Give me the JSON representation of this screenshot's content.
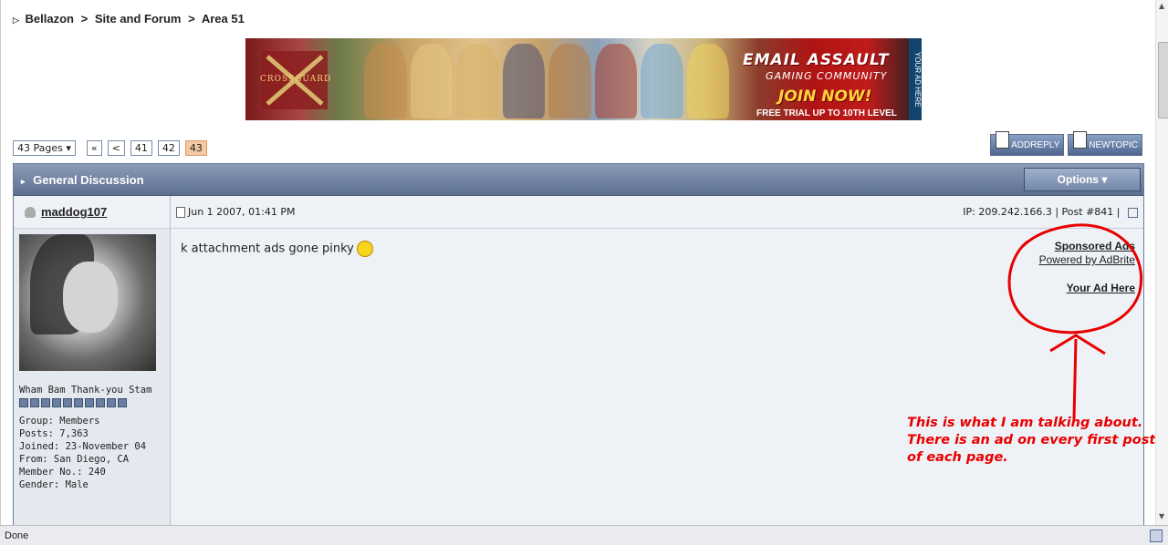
{
  "breadcrumb": {
    "items": [
      "Bellazon",
      "Site and Forum",
      "Area 51"
    ],
    "sep": ">"
  },
  "banner": {
    "brand": "CROSSGUARD",
    "line1": "EMAIL ASSAULT",
    "line2": "GAMING COMMUNITY",
    "line3": "JOIN NOW!",
    "line4": "FREE TRIAL UP TO 10TH LEVEL",
    "side": "YOUR AD HERE"
  },
  "pager": {
    "pages_label": "43 Pages ▾",
    "first": "«",
    "prev": "<",
    "pages": [
      "41",
      "42"
    ],
    "current": "43"
  },
  "buttons": {
    "reply": "ADDREPLY",
    "new_topic": "NEWTOPIC"
  },
  "forum": {
    "title": "General Discussion",
    "options": "Options ▾"
  },
  "post": {
    "username": "maddog107",
    "date": "Jun 1 2007, 01:41 PM",
    "ip_label": "IP:",
    "ip": "209.242.166.3",
    "post_label": "Post",
    "post_no": "#841",
    "body": "k attachment ads gone pinky",
    "user_title": "Wham Bam Thank-you Stam",
    "group": "Group: Members",
    "posts": "Posts: 7,363",
    "joined": "Joined: 23-November 04",
    "from": "From: San Diego, CA",
    "member_no": "Member No.: 240",
    "gender": "Gender: Male"
  },
  "sponsored": {
    "title": "Sponsored Ads",
    "powered": "Powered by AdBrite",
    "your_ad": "Your Ad Here"
  },
  "annotation": {
    "line1": "This is what I am talking about.",
    "line2": "There is an ad on every first post",
    "line3": "of each page."
  },
  "status": {
    "text": "Done"
  },
  "colors": {
    "annotation": "#e80000",
    "header": "#6b7d9a"
  }
}
